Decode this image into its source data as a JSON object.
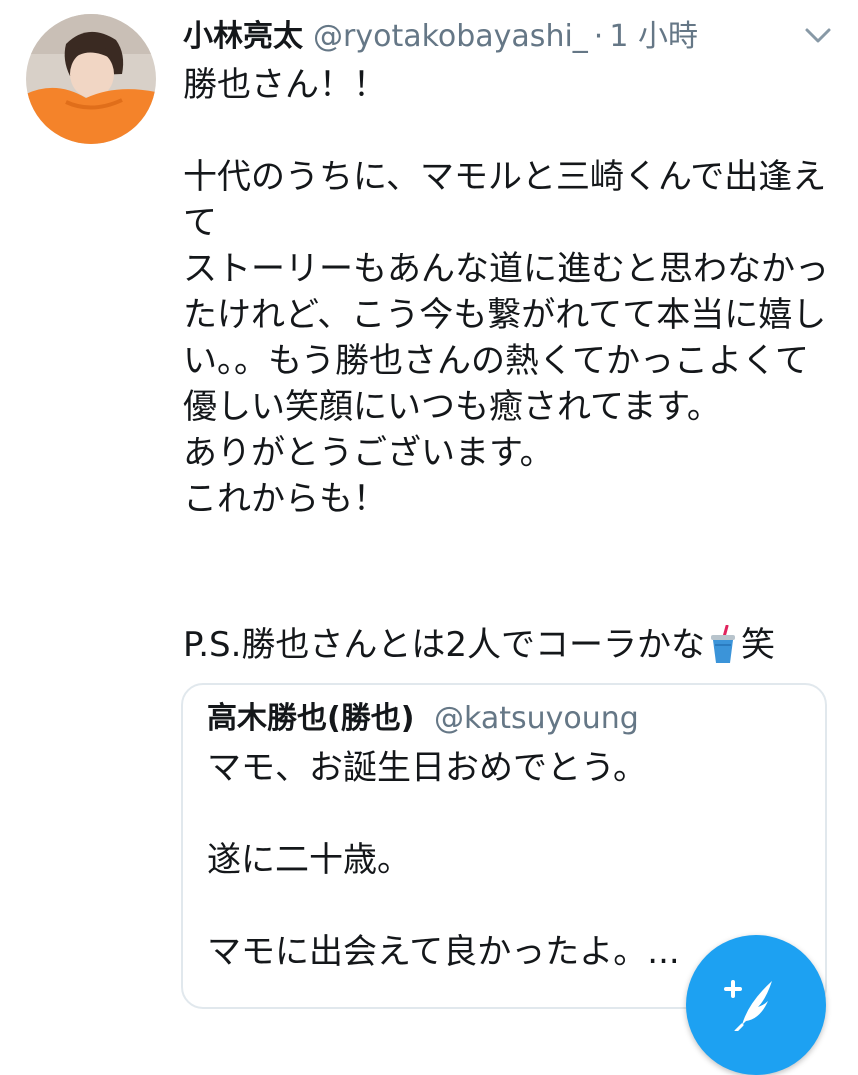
{
  "tweet": {
    "display_name": "小林亮太",
    "handle": "@ryotakobayashi_",
    "separator": "·",
    "time": "1 小時",
    "body": "勝也さん！！\n\n十代のうちに、マモルと三崎くんで出逢えて\nストーリーもあんな道に進むと思わなかったけれど、こう今も繋がれてて本当に嬉しい。。もう勝也さんの熱くてかっこよくて優しい笑顔にいつも癒されてます。\nありがとうございます。\nこれからも！",
    "ps_before": "P.S.勝也さんとは2人でコーラかな",
    "ps_after": "笑",
    "cup_icon": "cup-with-straw-icon"
  },
  "quoted_tweet": {
    "display_name": "高木勝也(勝也)",
    "handle": "@katsuyoung",
    "body": "マモ、お誕生日おめでとう。\n\n遂に二十歳。\n\nマモに出会えて良かったよ。..."
  },
  "compose_button": {
    "icon": "compose-feather-plus-icon",
    "color": "#1da1f2"
  },
  "colors": {
    "text": "#14171a",
    "secondary": "#657786",
    "border": "#e1e8ed",
    "accent": "#1da1f2"
  }
}
